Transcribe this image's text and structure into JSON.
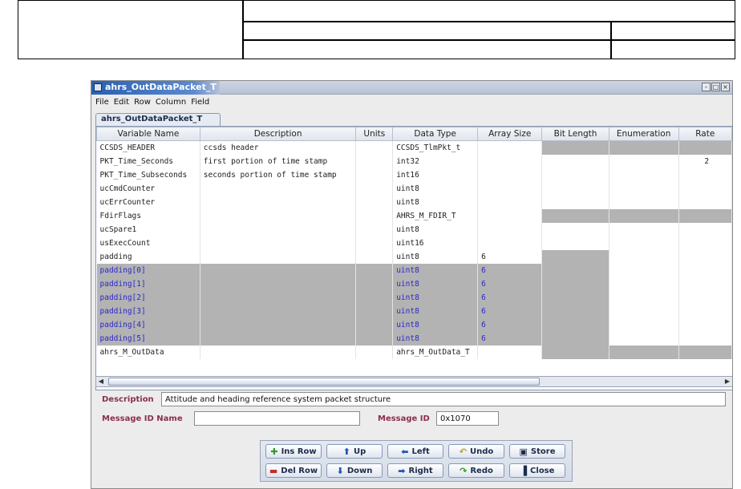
{
  "window": {
    "title": "ahrs_OutDataPacket_T",
    "tab_label": "ahrs_OutDataPacket_T",
    "controls": [
      "-",
      "□",
      "×"
    ]
  },
  "menu": [
    "File",
    "Edit",
    "Row",
    "Column",
    "Field"
  ],
  "table": {
    "columns": [
      "Variable Name",
      "Description",
      "Units",
      "Data Type",
      "Array Size",
      "Bit Length",
      "Enumeration",
      "Rate"
    ],
    "rows": [
      {
        "name": "CCSDS_HEADER",
        "desc": "ccsds header",
        "units": "",
        "type": "CCSDS_TlmPkt_t",
        "array": "",
        "bits": "",
        "enum": "",
        "rate": ""
      },
      {
        "name": "PKT_Time_Seconds",
        "desc": "first portion of time stamp",
        "units": "",
        "type": "int32",
        "array": "",
        "bits": "",
        "enum": "",
        "rate": "2"
      },
      {
        "name": "PKT_Time_Subseconds",
        "desc": "seconds portion of time stamp",
        "units": "",
        "type": "int16",
        "array": "",
        "bits": "",
        "enum": "",
        "rate": ""
      },
      {
        "name": "ucCmdCounter",
        "desc": "",
        "units": "",
        "type": "uint8",
        "array": "",
        "bits": "",
        "enum": "",
        "rate": ""
      },
      {
        "name": "ucErrCounter",
        "desc": "",
        "units": "",
        "type": "uint8",
        "array": "",
        "bits": "",
        "enum": "",
        "rate": ""
      },
      {
        "name": "FdirFlags",
        "desc": "",
        "units": "",
        "type": "AHRS_M_FDIR_T",
        "array": "",
        "bits": "",
        "enum": "",
        "rate": ""
      },
      {
        "name": "ucSpare1",
        "desc": "",
        "units": "",
        "type": "uint8",
        "array": "",
        "bits": "",
        "enum": "",
        "rate": ""
      },
      {
        "name": "usExecCount",
        "desc": "",
        "units": "",
        "type": "uint16",
        "array": "",
        "bits": "",
        "enum": "",
        "rate": ""
      },
      {
        "name": "padding",
        "desc": "",
        "units": "",
        "type": "uint8",
        "array": "6",
        "bits": "",
        "enum": "",
        "rate": ""
      },
      {
        "name": "padding[0]",
        "desc": "",
        "units": "",
        "type": "uint8",
        "array": "6",
        "bits": "",
        "enum": "",
        "rate": ""
      },
      {
        "name": "padding[1]",
        "desc": "",
        "units": "",
        "type": "uint8",
        "array": "6",
        "bits": "",
        "enum": "",
        "rate": ""
      },
      {
        "name": "padding[2]",
        "desc": "",
        "units": "",
        "type": "uint8",
        "array": "6",
        "bits": "",
        "enum": "",
        "rate": ""
      },
      {
        "name": "padding[3]",
        "desc": "",
        "units": "",
        "type": "uint8",
        "array": "6",
        "bits": "",
        "enum": "",
        "rate": ""
      },
      {
        "name": "padding[4]",
        "desc": "",
        "units": "",
        "type": "uint8",
        "array": "6",
        "bits": "",
        "enum": "",
        "rate": ""
      },
      {
        "name": "padding[5]",
        "desc": "",
        "units": "",
        "type": "uint8",
        "array": "6",
        "bits": "",
        "enum": "",
        "rate": ""
      },
      {
        "name": "ahrs_M_OutData",
        "desc": "",
        "units": "",
        "type": "ahrs_M_OutData_T",
        "array": "",
        "bits": "",
        "enum": "",
        "rate": ""
      }
    ]
  },
  "description": {
    "label": "Description",
    "value": "Attitude and heading reference system packet structure"
  },
  "message_id_name": {
    "label": "Message ID Name",
    "value": ""
  },
  "message_id": {
    "label": "Message ID",
    "value": "0x1070"
  },
  "buttons": {
    "ins_row": "Ins Row",
    "up": "Up",
    "left": "Left",
    "undo": "Undo",
    "store": "Store",
    "del_row": "Del Row",
    "down": "Down",
    "right": "Right",
    "redo": "Redo",
    "close": "Close"
  },
  "colors": {
    "label": "#8b2e52",
    "selected_text": "#2b28c8",
    "disabled_cell": "#b3b3b3"
  }
}
